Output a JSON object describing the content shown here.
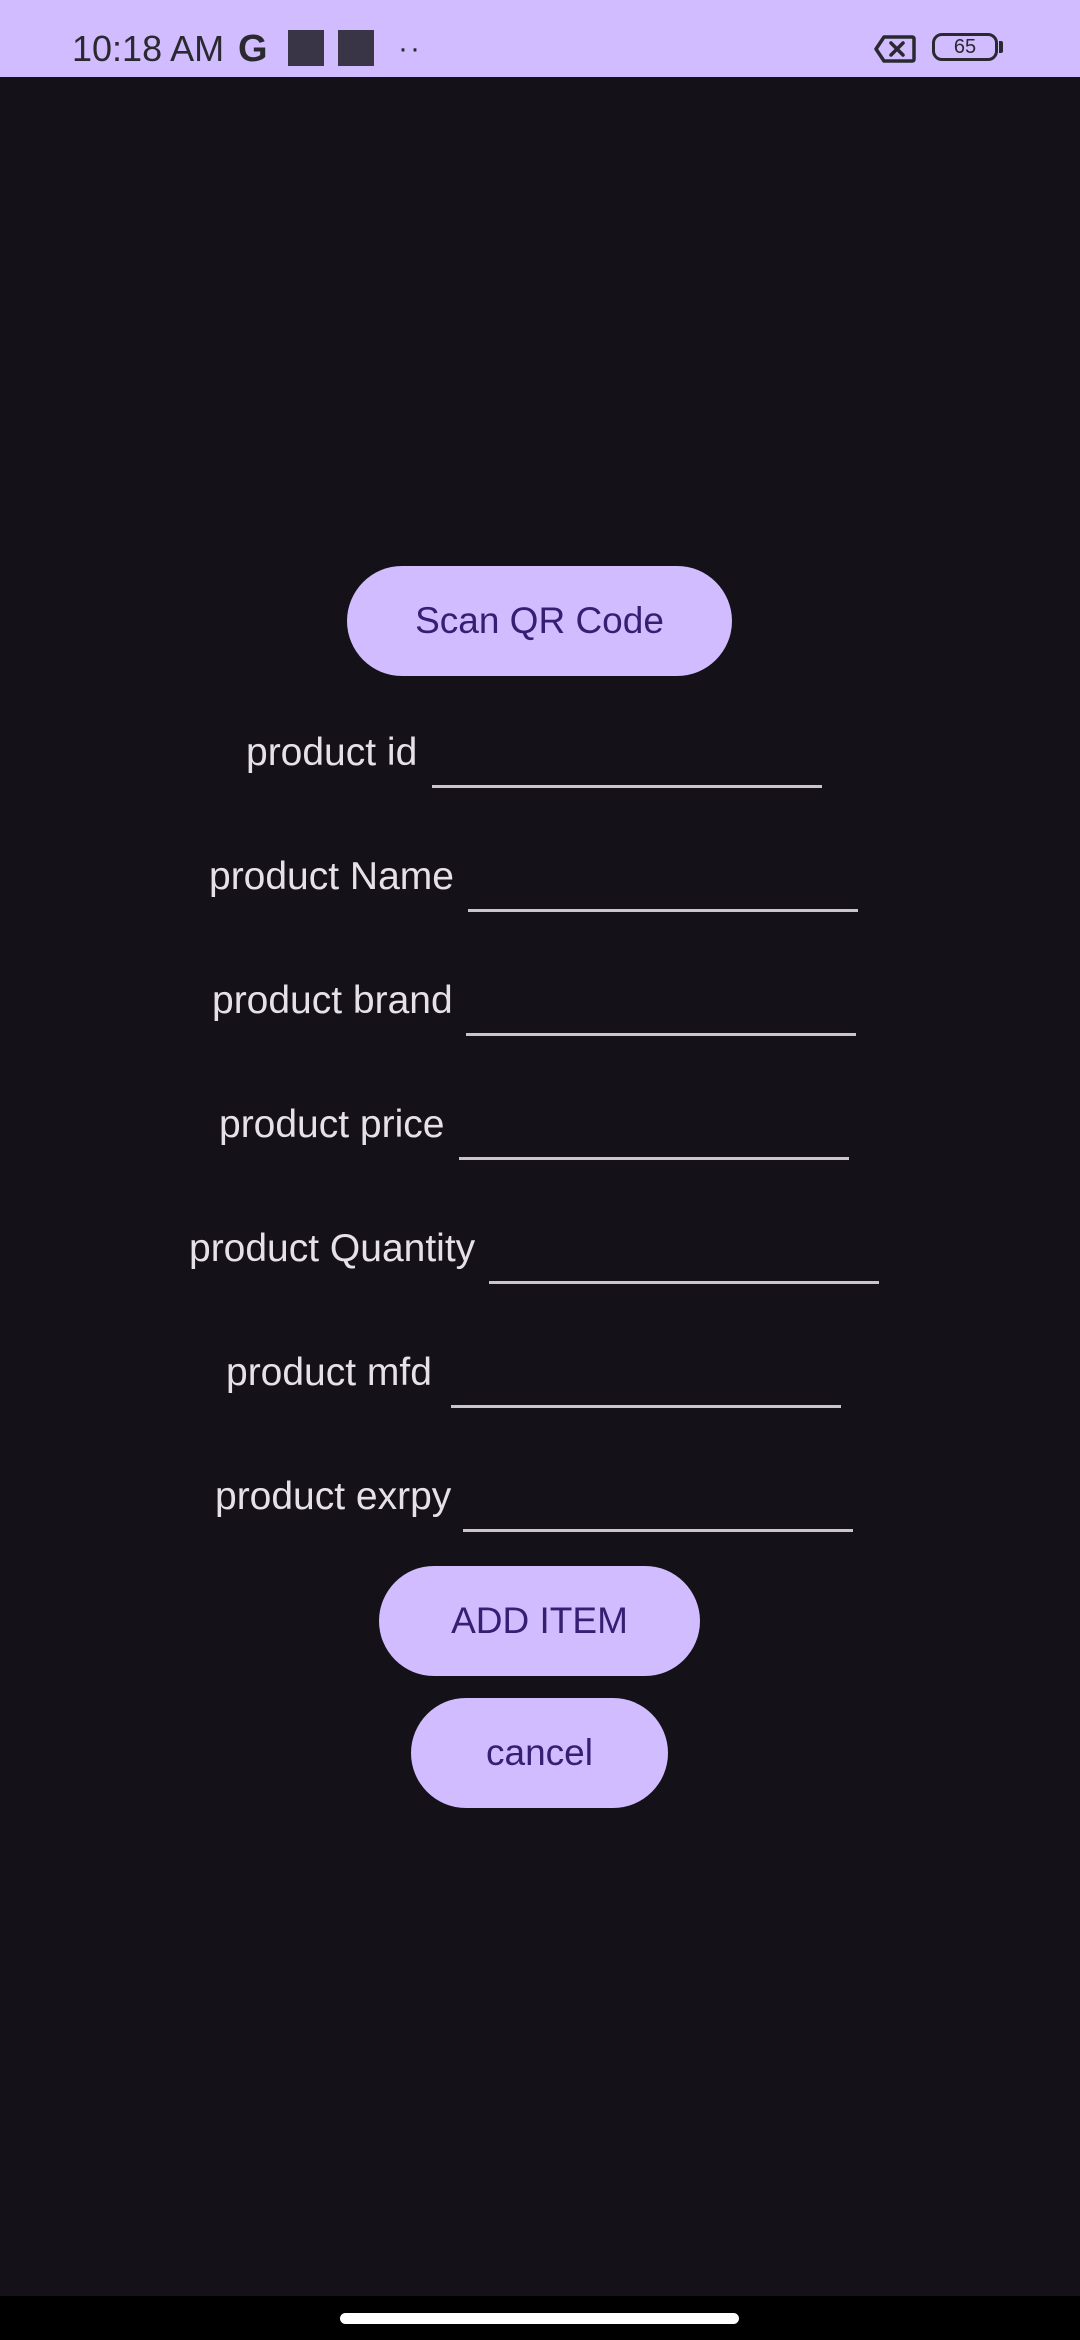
{
  "status_bar": {
    "time": "10:18 AM",
    "g_icon": "G",
    "overflow_dots": "··",
    "battery_level": "65",
    "icons": [
      "google-icon",
      "notification-square-icon",
      "notification-square-icon",
      "more-dots-icon",
      "no-sim-icon",
      "battery-icon"
    ]
  },
  "form": {
    "scan_button": "Scan QR Code",
    "fields": [
      {
        "label": "product id",
        "value": ""
      },
      {
        "label": "product Name",
        "value": ""
      },
      {
        "label": "product brand",
        "value": ""
      },
      {
        "label": "product price",
        "value": ""
      },
      {
        "label": "product Quantity",
        "value": ""
      },
      {
        "label": "product mfd",
        "value": ""
      },
      {
        "label": "product exrpy",
        "value": ""
      }
    ],
    "add_button": "ADD ITEM",
    "cancel_button": "cancel"
  },
  "colors": {
    "background": "#141218",
    "accent": "#d0bcff",
    "button_text": "#381e72",
    "label_text": "#e6e0e9"
  }
}
